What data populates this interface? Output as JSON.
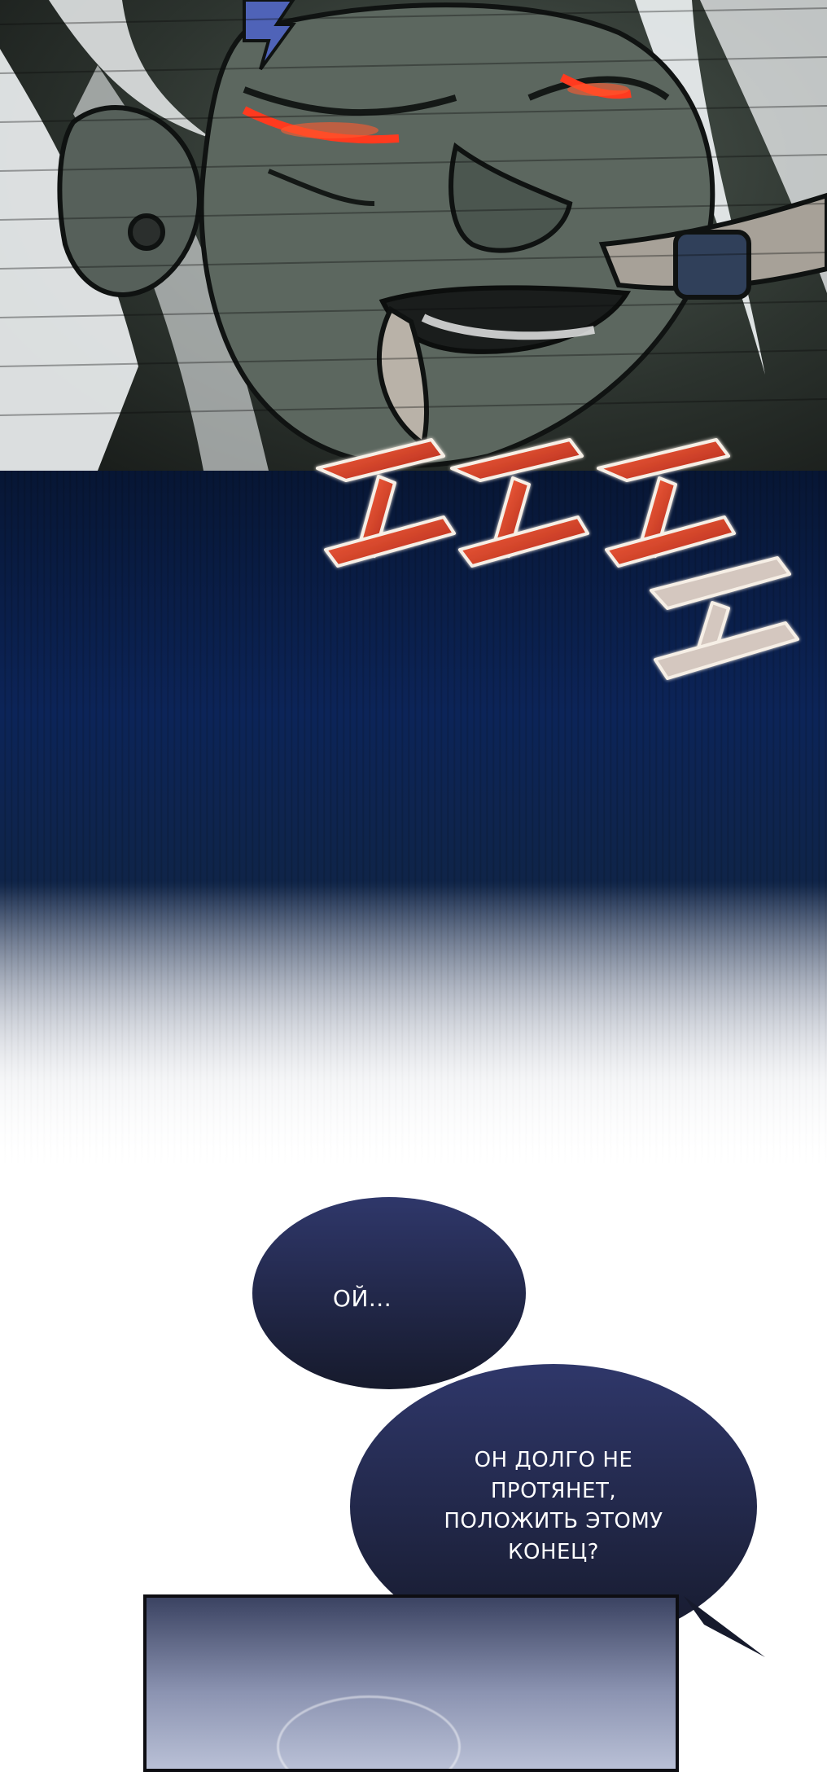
{
  "speech": {
    "bubble_1": "ОЙ...",
    "bubble_2": "ОН ДОЛГО НЕ ПРОТЯНЕТ, ПОЛОЖИТЬ ЭТОМУ КОНЕЦ?"
  },
  "colors": {
    "bubble_fill": "#2a3160",
    "sfx_red": "#d9452b",
    "night_blue": "#0c2458"
  }
}
